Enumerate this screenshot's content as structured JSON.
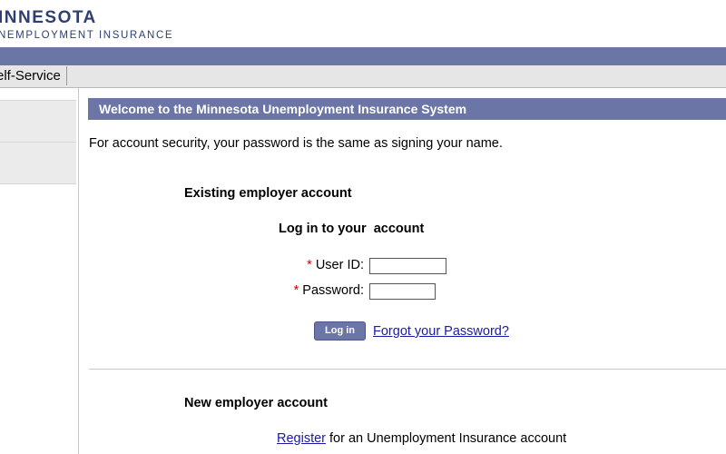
{
  "header": {
    "logo_name": "INNESOTA",
    "logo_subtitle": "NEMPLOYMENT INSURANCE"
  },
  "nav": {
    "tab_label": "elf-Service"
  },
  "main": {
    "welcome_title": "Welcome to the Minnesota Unemployment Insurance System",
    "security_note": "For account security, your password is the same as signing your name.",
    "existing_heading": "Existing employer account",
    "login_heading": "Log in to your  account",
    "user_id_label": "User ID:",
    "password_label": "Password:",
    "required_marker": "*",
    "user_id_value": "",
    "password_value": "",
    "login_button": "Log in",
    "forgot_link": "Forgot your Password?",
    "new_heading": "New employer account",
    "register_link": "Register",
    "register_text": " for an Unemployment Insurance account"
  },
  "colors": {
    "brand_navy": "#2e3f70",
    "bar_blue": "#6b76a6",
    "link_blue": "#1a1aa6",
    "required_red": "#cc0000"
  }
}
